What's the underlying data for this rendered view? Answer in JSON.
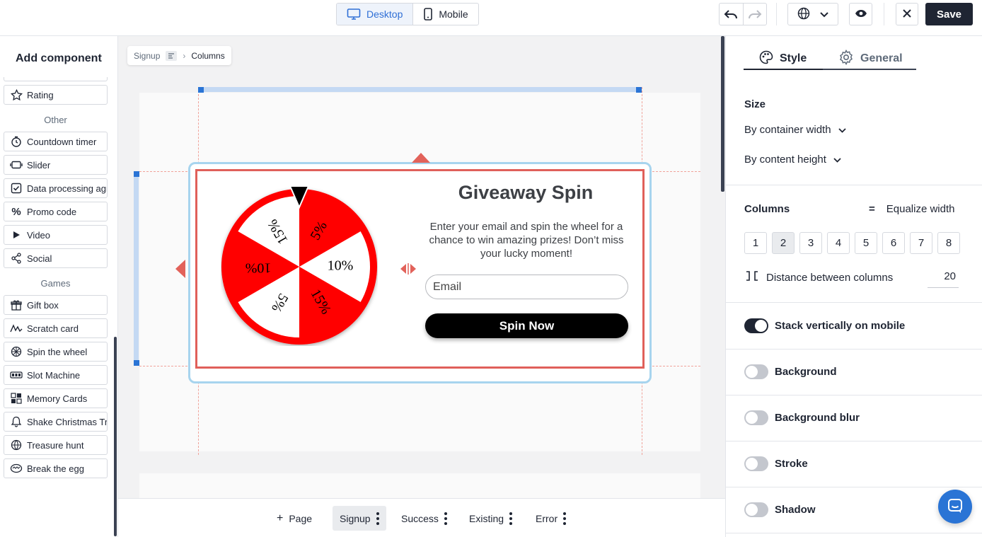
{
  "topbar": {
    "desktop_label": "Desktop",
    "mobile_label": "Mobile",
    "save_label": "Save"
  },
  "left_panel": {
    "title": "Add component",
    "items_top": [
      {
        "label": "Rating",
        "icon": "star-icon"
      }
    ],
    "groups": [
      {
        "title": "Other",
        "items": [
          {
            "label": "Countdown timer",
            "icon": "timer-icon"
          },
          {
            "label": "Slider",
            "icon": "slider-icon"
          },
          {
            "label": "Data processing agreement",
            "icon": "checkbox-icon"
          },
          {
            "label": "Promo code",
            "icon": "percent-icon"
          },
          {
            "label": "Video",
            "icon": "play-icon"
          },
          {
            "label": "Social",
            "icon": "share-icon"
          }
        ]
      },
      {
        "title": "Games",
        "items": [
          {
            "label": "Gift box",
            "icon": "gift-icon"
          },
          {
            "label": "Scratch card",
            "icon": "scratch-icon"
          },
          {
            "label": "Spin the wheel",
            "icon": "wheel-icon"
          },
          {
            "label": "Slot Machine",
            "icon": "slot-machine-icon"
          },
          {
            "label": "Memory Cards",
            "icon": "memory-cards-icon"
          },
          {
            "label": "Shake Christmas Tree",
            "icon": "bell-icon"
          },
          {
            "label": "Treasure hunt",
            "icon": "globe-icon"
          },
          {
            "label": "Break the egg",
            "icon": "egg-icon"
          }
        ]
      }
    ]
  },
  "canvas": {
    "breadcrumb": {
      "parent": "Signup",
      "current": "Columns"
    },
    "popup": {
      "title": "Giveaway Spin",
      "description": "Enter your email and spin the wheel for a chance to win amazing prizes! Don’t miss your lucky moment!",
      "email_placeholder": "Email",
      "button_label": "Spin Now",
      "wheel_segments": [
        "5%",
        "10%",
        "15%",
        "5%",
        "10%",
        "15%"
      ],
      "wheel_colors": {
        "primary": "#ff0000",
        "secondary": "#ffffff",
        "rim": "#ff0000",
        "pointer": "#000000"
      }
    },
    "pages": {
      "add_label": "Page",
      "tabs": [
        "Signup",
        "Success",
        "Existing",
        "Error"
      ],
      "active": "Signup"
    }
  },
  "right_panel": {
    "tabs": {
      "style": "Style",
      "general": "General",
      "active": "Style"
    },
    "size_label": "Size",
    "width_mode": "By container width",
    "height_mode": "By content height",
    "columns_label": "Columns",
    "equalize_label": "Equalize width",
    "column_options": [
      "1",
      "2",
      "3",
      "4",
      "5",
      "6",
      "7",
      "8"
    ],
    "columns_selected": "2",
    "distance_label": "Distance between columns",
    "distance_value": "20",
    "toggles": [
      {
        "label": "Stack vertically on mobile",
        "on": true
      },
      {
        "label": "Background",
        "on": false
      },
      {
        "label": "Background blur",
        "on": false
      },
      {
        "label": "Stroke",
        "on": false
      },
      {
        "label": "Shadow",
        "on": false
      }
    ]
  },
  "colors": {
    "brand_dark": "#1f2533",
    "accent_blue": "#2a74d5",
    "selection_red": "#e0605a"
  }
}
